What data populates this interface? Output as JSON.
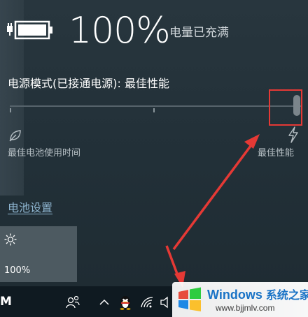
{
  "battery": {
    "percent_text": "100%",
    "status": "电量已充满",
    "level": 1.0
  },
  "power_mode": {
    "title": "电源模式(已接通电源): 最佳性能",
    "slider_value": 1.0,
    "left_label": "最佳电池使用时间",
    "right_label": "最佳性能",
    "left_icon": "leaf-icon",
    "right_icon": "lightning-bolt-icon"
  },
  "links": {
    "battery_settings": "电池设置"
  },
  "quick_action": {
    "brightness_value": "100%",
    "icon": "sun-icon"
  },
  "taskbar": {
    "ime": "M",
    "icons": [
      "people-icon",
      "chevron-up-icon",
      "qq-penguin-icon",
      "wifi-icon",
      "volume-icon"
    ]
  },
  "watermark": {
    "title": "Windows",
    "title_cn": "系统之家",
    "url": "www.bjjmlv.com"
  },
  "colors": {
    "annotation": "#e53935",
    "link": "#8fb6d1",
    "watermark_blue": "#1a73c6"
  }
}
